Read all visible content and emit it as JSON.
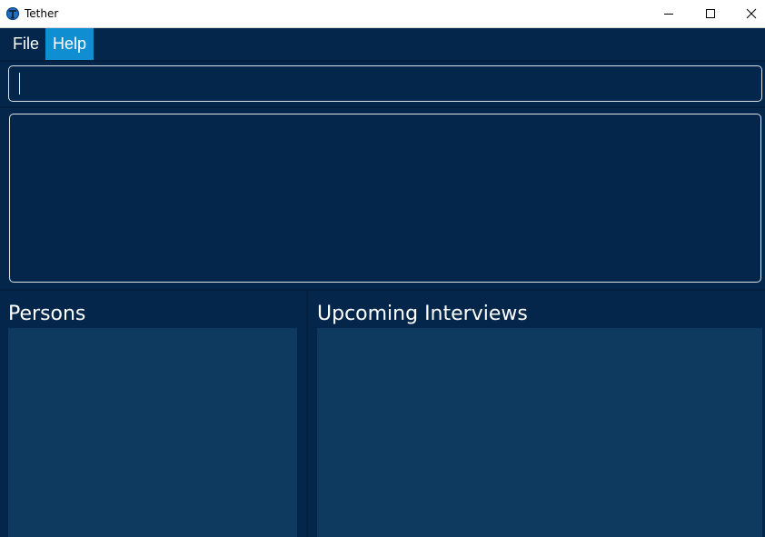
{
  "window": {
    "title": "Tether",
    "icon": "tether-logo-icon",
    "controls": [
      "minimize-icon",
      "maximize-icon",
      "close-icon"
    ]
  },
  "menu": {
    "items": [
      {
        "label": "File"
      },
      {
        "label": "Help",
        "highlighted": true
      }
    ]
  },
  "command_box": {
    "value": "",
    "placeholder": ""
  },
  "result_display": {
    "text": ""
  },
  "persons_panel": {
    "title": "Persons",
    "items": []
  },
  "interviews_panel": {
    "title": "Upcoming Interviews",
    "items": []
  },
  "colors": {
    "background": "#03264a",
    "list_background": "#0d3a5e",
    "menu_highlight": "#0f8fd1",
    "border": "#dbe2ea"
  }
}
